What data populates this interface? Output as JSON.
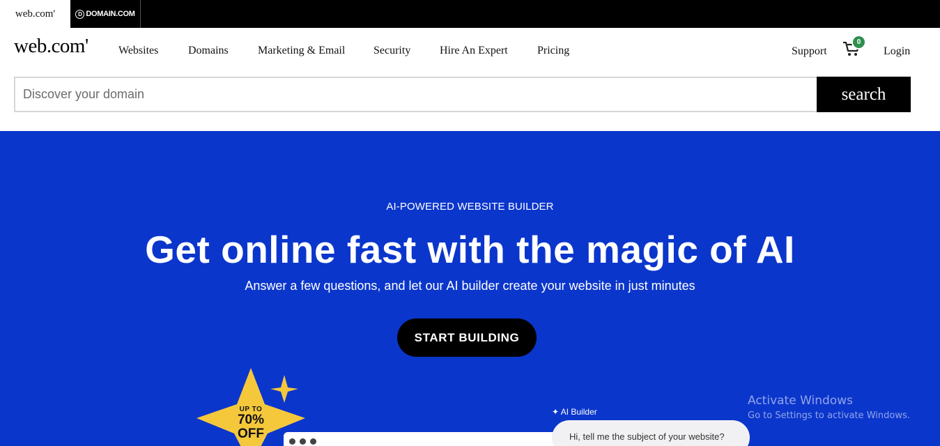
{
  "brand_tabs": {
    "webcom": "web.com'",
    "domaincom": "DOMAIN.COM",
    "domaincom_mark": "D"
  },
  "header": {
    "logo": "web.com'",
    "nav": [
      "Websites",
      "Domains",
      "Marketing & Email",
      "Security",
      "Hire An Expert",
      "Pricing"
    ],
    "support": "Support",
    "cart_count": "0",
    "login": "Login",
    "cart_icon": "shopping-cart-icon"
  },
  "search": {
    "placeholder": "Discover your domain",
    "button_label": "search"
  },
  "hero": {
    "eyebrow": "AI-POWERED WEBSITE BUILDER",
    "headline": "Get online fast with the magic of AI",
    "subline": "Answer a few questions, and let our AI builder create your website in just minutes",
    "cta": "START BUILDING",
    "promo": {
      "up_to": "UP TO",
      "percent": "70%",
      "off": "OFF"
    },
    "ai_label": "AI Builder",
    "chat_prompt": "Hi, tell me the subject of your website?"
  },
  "windows_watermark": {
    "title": "Activate Windows",
    "subtitle": "Go to Settings to activate Windows."
  },
  "colors": {
    "hero_bg": "#0b36cc",
    "promo_star": "#f5c83c",
    "cart_badge": "#2f8f4f"
  }
}
